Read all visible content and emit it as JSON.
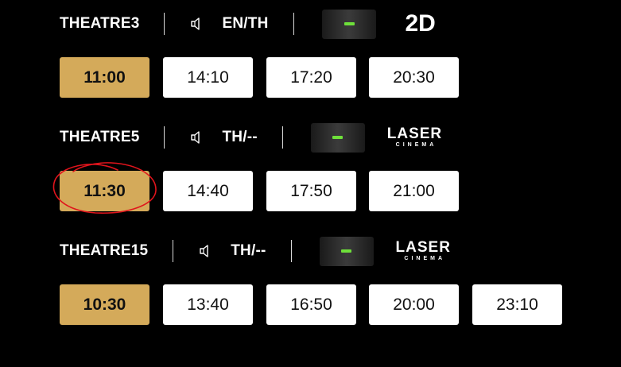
{
  "theatres": [
    {
      "name": "THEATRE3",
      "language": "EN/TH",
      "rating_icon": "dash-rating-icon",
      "format": "2D",
      "times": [
        "11:00",
        "14:10",
        "17:20",
        "20:30"
      ],
      "selected_time": "11:00"
    },
    {
      "name": "THEATRE5",
      "language": "TH/--",
      "rating_icon": "dash-rating-icon",
      "format_logo": {
        "main": "LASER",
        "sub": "CINEMA"
      },
      "times": [
        "11:30",
        "14:40",
        "17:50",
        "21:00"
      ],
      "selected_time": "11:30"
    },
    {
      "name": "THEATRE15",
      "language": "TH/--",
      "rating_icon": "dash-rating-icon",
      "format_logo": {
        "main": "LASER",
        "sub": "CINEMA"
      },
      "times": [
        "10:30",
        "13:40",
        "16:50",
        "20:00",
        "23:10"
      ],
      "selected_time": "10:30"
    }
  ],
  "colors": {
    "background": "#000000",
    "selected_time": "#d4aa5a",
    "time_button": "#ffffff",
    "rating_dash": "#6ee03a",
    "annotation_circle": "#e0141c"
  },
  "icons": {
    "speaker": "speaker-icon"
  }
}
